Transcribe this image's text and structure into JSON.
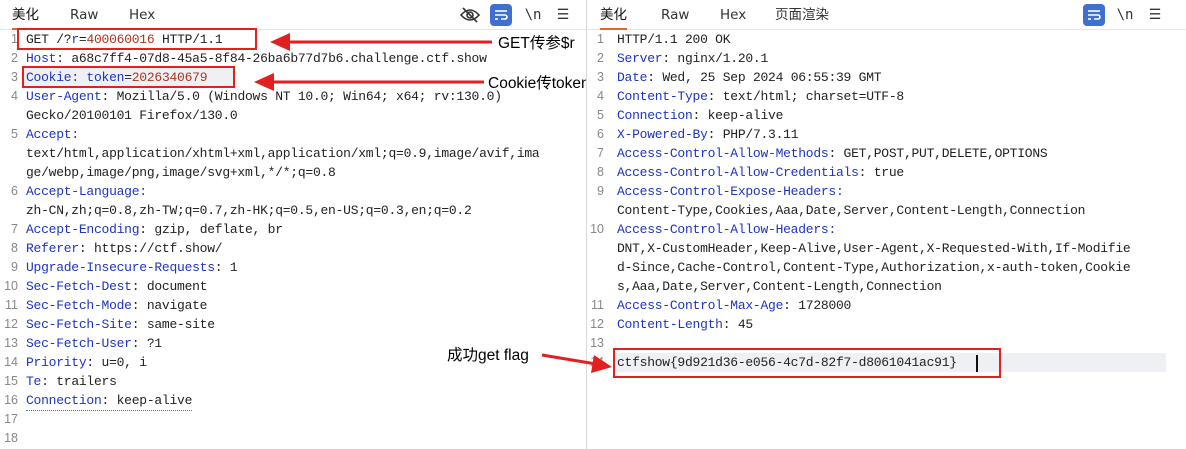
{
  "request_pane": {
    "tabs": [
      "美化",
      "Raw",
      "Hex"
    ],
    "active_tab": "美化",
    "toolbar_icons": [
      "eye-off-icon",
      "wrap-icon",
      "newline-icon",
      "menu-icon"
    ],
    "newline_label": "\\n",
    "menu_label": "☰",
    "line_numbers": [
      "1",
      "2",
      "3",
      "4",
      "",
      "5",
      "",
      "",
      "6",
      "",
      "7",
      "8",
      "9",
      "10",
      "11",
      "12",
      "13",
      "14",
      "15",
      "16",
      "17",
      "18"
    ],
    "request_line": {
      "method": "GET",
      "path_prefix": "/?",
      "param_key": "r",
      "eq": "=",
      "param_val": "400060016",
      "proto": "HTTP/1.1"
    },
    "headers": {
      "host_key": "Host",
      "host_val": "a68c7ff4-07d8-45a5-8f84-26ba6b77d7b6.challenge.ctf.show",
      "cookie_key": "Cookie",
      "cookie_sub": "token",
      "cookie_eq": "=",
      "cookie_val": "2026340679",
      "ua_key": "User-Agent",
      "ua_val_1": "Mozilla/5.0 (Windows NT 10.0; Win64; x64; rv:130.0)",
      "ua_val_2": "Gecko/20100101 Firefox/130.0",
      "accept_key": "Accept",
      "accept_val_1": "text/html,application/xhtml+xml,application/xml;q=0.9,image/avif,ima",
      "accept_val_2": "ge/webp,image/png,image/svg+xml,*/*;q=0.8",
      "al_key": "Accept-Language",
      "al_val": "zh-CN,zh;q=0.8,zh-TW;q=0.7,zh-HK;q=0.5,en-US;q=0.3,en;q=0.2",
      "ae_key": "Accept-Encoding",
      "ae_val": "gzip, deflate, br",
      "ref_key": "Referer",
      "ref_val": "https://ctf.show/",
      "uir_key": "Upgrade-Insecure-Requests",
      "uir_val": "1",
      "sfd_key": "Sec-Fetch-Dest",
      "sfd_val": "document",
      "sfm_key": "Sec-Fetch-Mode",
      "sfm_val": "navigate",
      "sfs_key": "Sec-Fetch-Site",
      "sfs_val": "same-site",
      "sfu_key": "Sec-Fetch-User",
      "sfu_val": "?1",
      "pri_key": "Priority",
      "pri_val": "u=0, i",
      "te_key": "Te",
      "te_val": "trailers",
      "conn_key": "Connection",
      "conn_val": "keep-alive"
    },
    "annotations": {
      "get_note": "GET传参$r",
      "cookie_note": "Cookie传token"
    }
  },
  "response_pane": {
    "tabs": [
      "美化",
      "Raw",
      "Hex",
      "页面渲染"
    ],
    "active_tab": "美化",
    "toolbar_icons": [
      "wrap-icon",
      "newline-icon",
      "menu-icon"
    ],
    "newline_label": "\\n",
    "menu_label": "☰",
    "line_numbers": [
      "1",
      "2",
      "3",
      "4",
      "5",
      "6",
      "7",
      "8",
      "9",
      "",
      "10",
      "",
      "",
      "11",
      "12",
      "13",
      "14"
    ],
    "status_line": "HTTP/1.1 200 OK",
    "headers": {
      "server_key": "Server",
      "server_val": "nginx/1.20.1",
      "date_key": "Date",
      "date_val": "Wed, 25 Sep 2024 06:55:39 GMT",
      "ct_key": "Content-Type",
      "ct_val": "text/html; charset=UTF-8",
      "conn_key": "Connection",
      "conn_val": "keep-alive",
      "xpb_key": "X-Powered-By",
      "xpb_val": "PHP/7.3.11",
      "acam_key": "Access-Control-Allow-Methods",
      "acam_val": "GET,POST,PUT,DELETE,OPTIONS",
      "acac_key": "Access-Control-Allow-Credentials",
      "acac_val": "true",
      "aceh_key": "Access-Control-Expose-Headers",
      "aceh_val": "Content-Type,Cookies,Aaa,Date,Server,Content-Length,Connection",
      "acah_key": "Access-Control-Allow-Headers",
      "acah_val_1": "DNT,X-CustomHeader,Keep-Alive,User-Agent,X-Requested-With,If-Modifie",
      "acah_val_2": "d-Since,Cache-Control,Content-Type,Authorization,x-auth-token,Cookie",
      "acah_val_3": "s,Aaa,Date,Server,Content-Length,Connection",
      "acma_key": "Access-Control-Max-Age",
      "acma_val": "1728000",
      "cl_key": "Content-Length",
      "cl_val": "45"
    },
    "body": "ctfshow{9d921d36-e056-4c7d-82f7-d8061041ac91}",
    "annotations": {
      "flag_note": "成功get flag"
    }
  },
  "colors": {
    "accent": "#e8632b",
    "header_key": "#1d34c4",
    "number": "#b0321f",
    "annotation_red": "#e32020",
    "toolbar_blue": "#3f6fd0"
  }
}
